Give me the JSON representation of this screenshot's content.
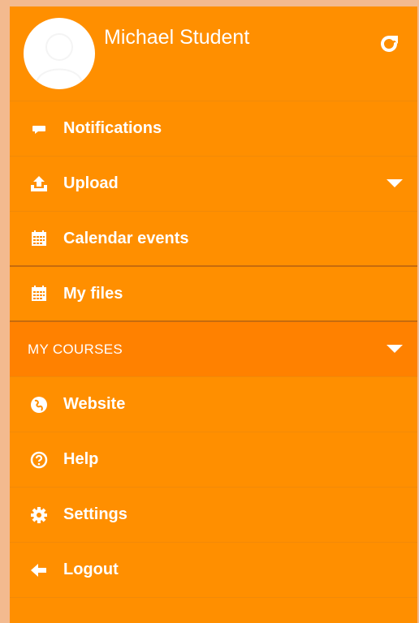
{
  "colors": {
    "menu_background": "#ff8f00",
    "section_header_background": "#ff8100",
    "frame_background": "#f3ba8f",
    "text": "#ffffff"
  },
  "profile": {
    "name": "Michael Student",
    "refresh_icon": "refresh-icon"
  },
  "menu": {
    "items": [
      {
        "label": "Notifications",
        "icon": "comment-icon"
      },
      {
        "label": "Upload",
        "icon": "upload-icon",
        "expandable": true
      },
      {
        "label": "Calendar events",
        "icon": "calendar-icon"
      },
      {
        "label": "My files",
        "icon": "calendar-icon"
      }
    ],
    "section": {
      "label": "MY COURSES",
      "expandable": true
    },
    "footer_items": [
      {
        "label": "Website",
        "icon": "globe-icon"
      },
      {
        "label": "Help",
        "icon": "help-icon"
      },
      {
        "label": "Settings",
        "icon": "gear-icon"
      },
      {
        "label": "Logout",
        "icon": "arrow-left-icon"
      }
    ]
  }
}
